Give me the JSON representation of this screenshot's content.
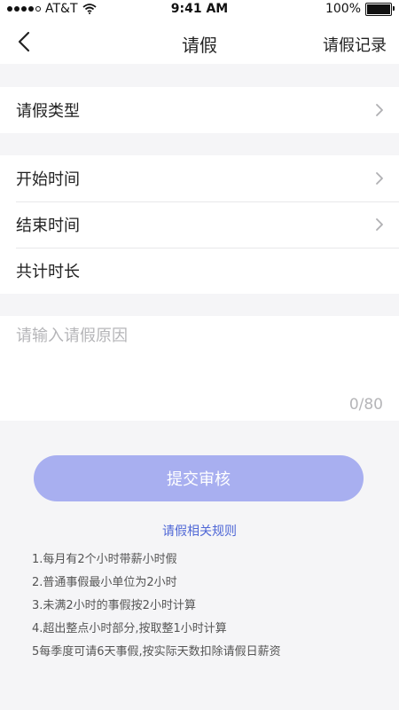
{
  "status_bar": {
    "carrier": "AT&T",
    "time": "9:41 AM",
    "battery": "100%",
    "battery_level": 1.0
  },
  "header": {
    "title": "请假",
    "records_label": "请假记录"
  },
  "form": {
    "leave_type_label": "请假类型",
    "start_time_label": "开始时间",
    "end_time_label": "结束时间",
    "duration_label": "共计时长"
  },
  "reason": {
    "placeholder": "请输入请假原因",
    "counter": "0/80"
  },
  "submit_label": "提交审核",
  "rules": {
    "title": "请假相关规则",
    "items": [
      "1.每月有2个小时带薪小时假",
      "2.普通事假最小单位为2小时",
      "3.未满2小时的事假按2小时计算",
      "4.超出整点小时部分,按取整1小时计算",
      "5每季度可请6天事假,按实际天数扣除请假日薪资"
    ]
  },
  "colors": {
    "accent": "#4f67d6",
    "button": "#a8aff0",
    "background": "#f5f5f7"
  }
}
